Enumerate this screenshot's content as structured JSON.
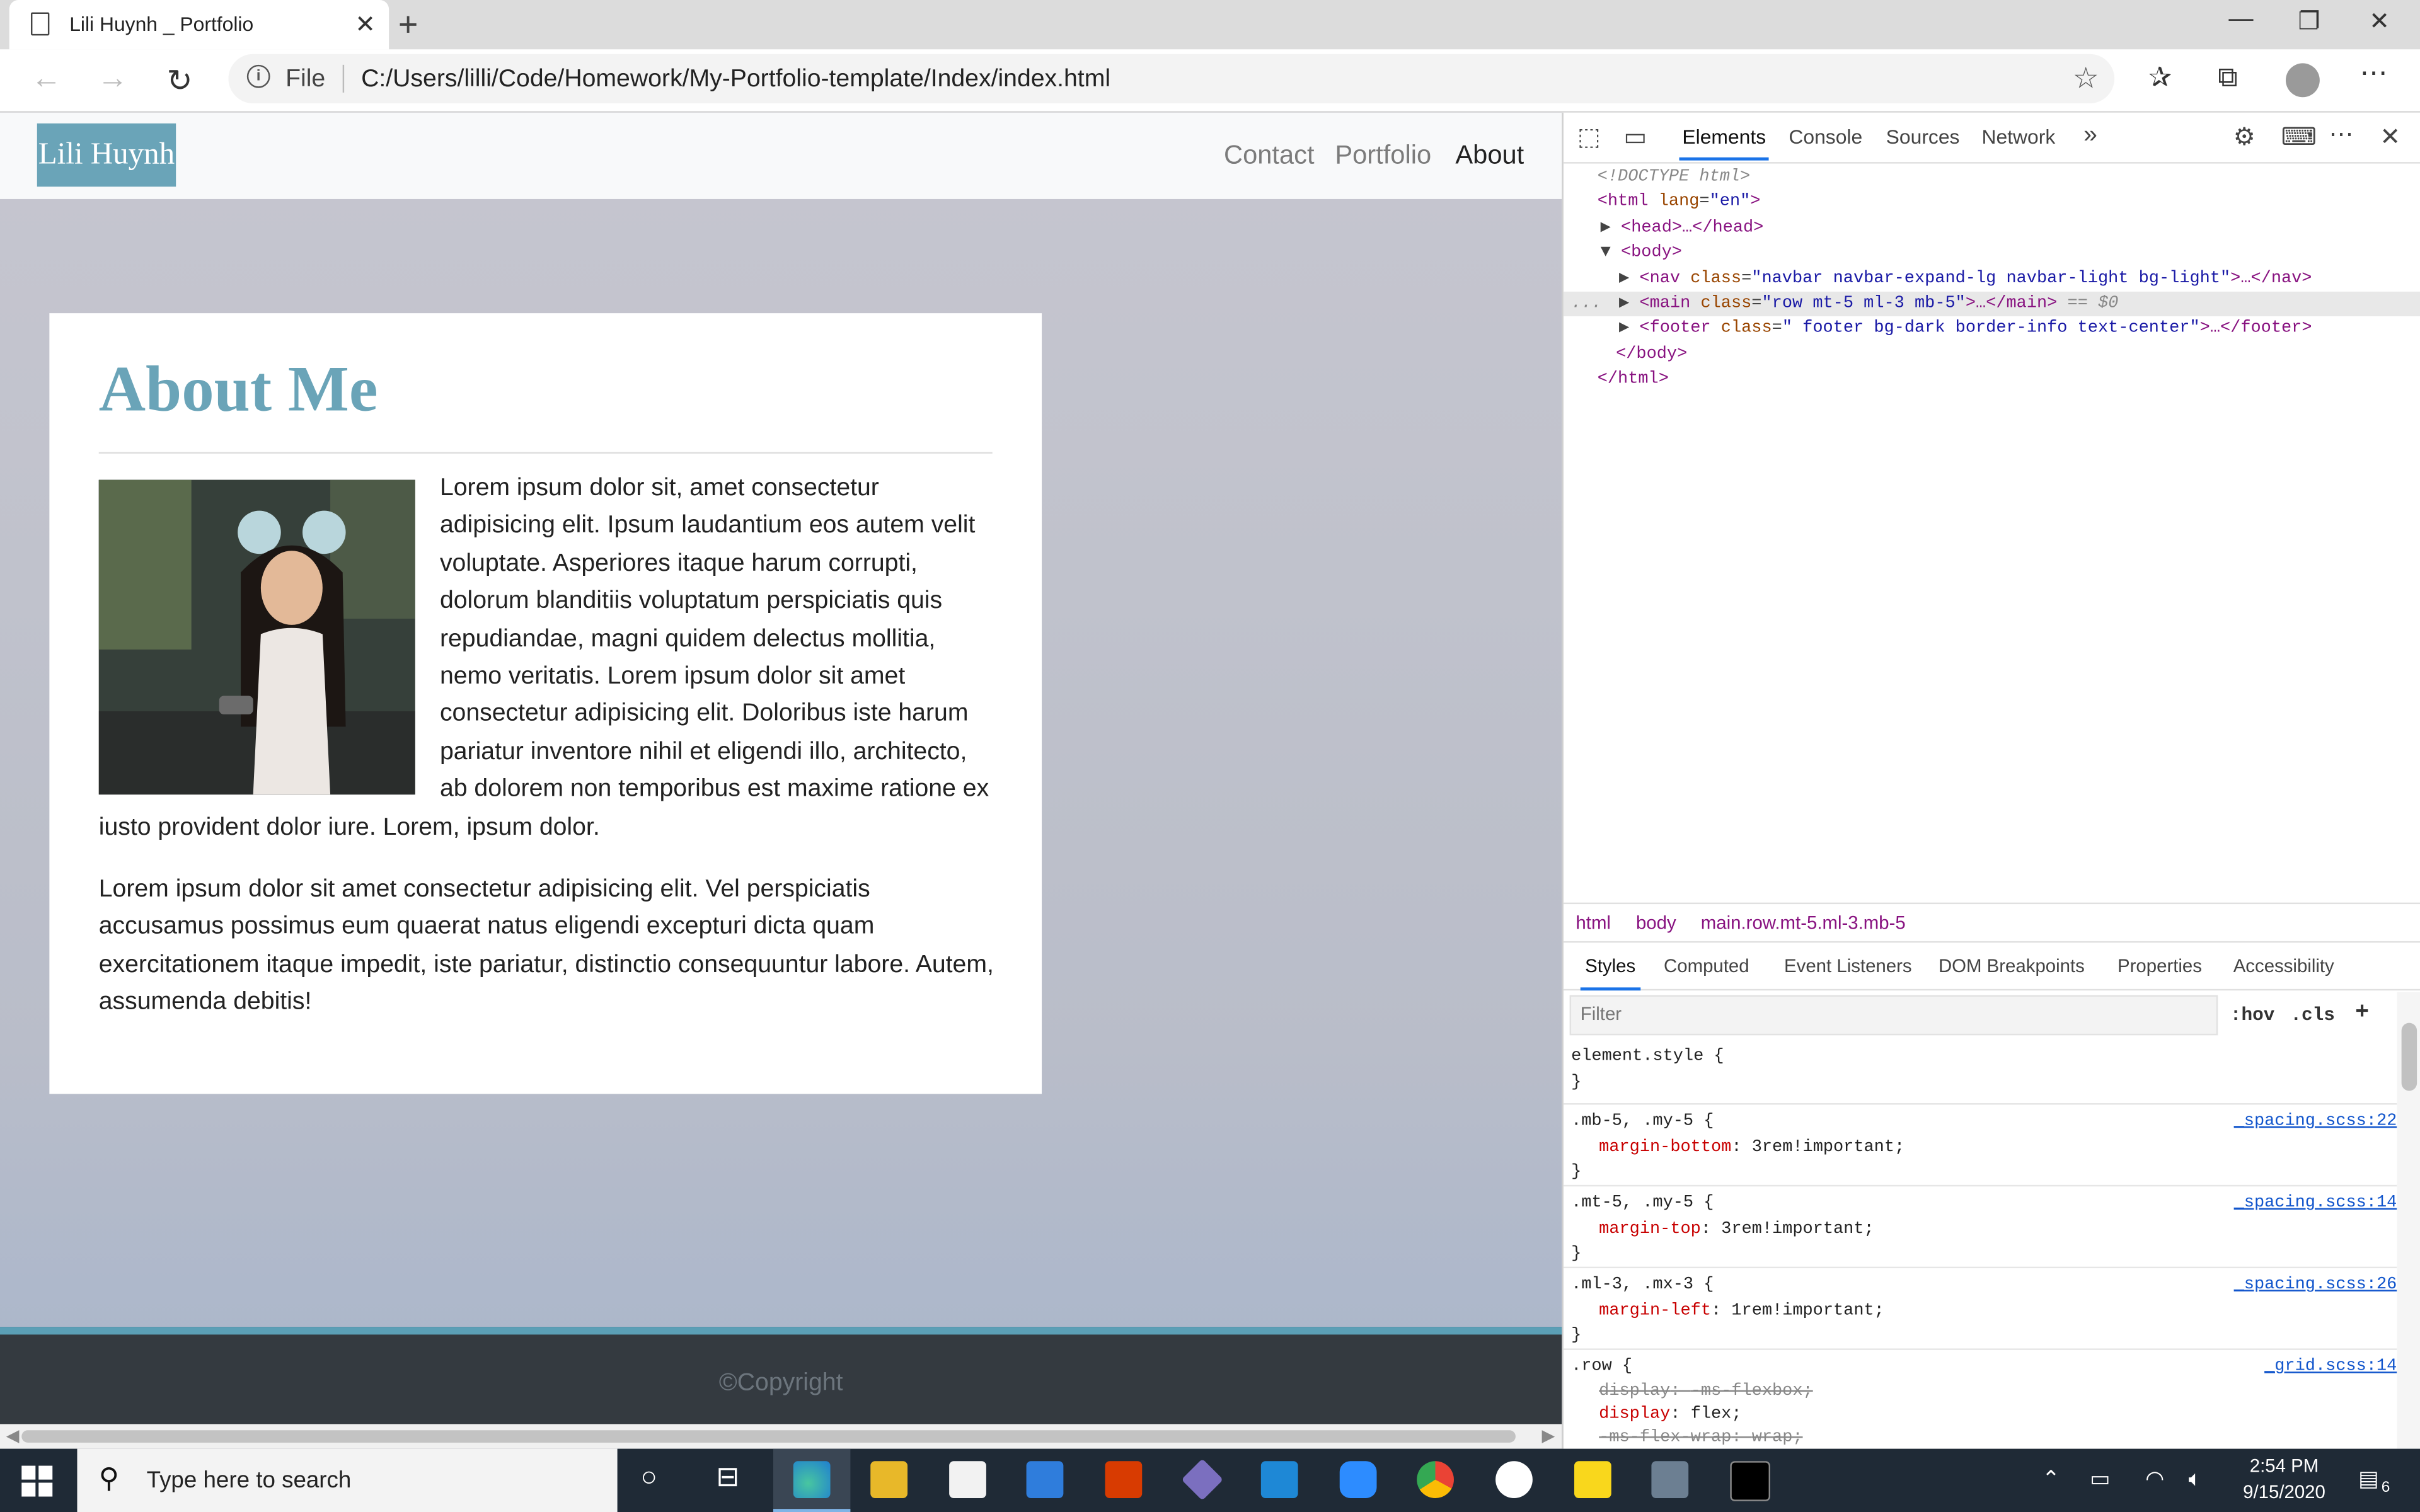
{
  "browser": {
    "tab_title": "Lili Huynh _ Portfolio",
    "file_label": "File",
    "url": "C:/Users/lilli/Code/Homework/My-Portfolio-template/Index/index.html"
  },
  "site": {
    "brand": "Lili Huynh",
    "nav": [
      "Contact",
      "Portfolio",
      "About"
    ],
    "active_nav": "About",
    "heading": "About Me",
    "paragraph1": "Lorem ipsum dolor sit, amet consectetur adipisicing elit. Ipsum laudantium eos autem velit voluptate. Asperiores itaque harum corrupti, dolorum blanditiis voluptatum perspiciatis quis repudiandae, magni quidem delectus mollitia, nemo veritatis. Lorem ipsum dolor sit amet consectetur adipisicing elit. Doloribus iste harum pariatur inventore nihil et eligendi illo, architecto, ab dolorem non temporibus est maxime ratione ex iusto provident dolor iure. Lorem, ipsum dolor.",
    "paragraph2": "Lorem ipsum dolor sit amet consectetur adipisicing elit. Vel perspiciatis accusamus possimus eum quaerat natus eligendi excepturi dicta quam exercitationem itaque impedit, iste pariatur, distinctio consequuntur labore. Autem, assumenda debitis!",
    "footer": "©Copyright"
  },
  "devtools": {
    "tabs": [
      "Elements",
      "Console",
      "Sources",
      "Network"
    ],
    "active_tab": "Elements",
    "dom": {
      "doctype": "<!DOCTYPE html>",
      "html_open": "<html",
      "html_lang_attr": "lang",
      "html_lang_val": "\"en\"",
      "head": "<head>…</head>",
      "body_open": "<body>",
      "nav_tag": "<nav",
      "nav_class": "\"navbar navbar-expand-lg navbar-light bg-light\"",
      "nav_end": ">…</nav>",
      "main_tag": "<main",
      "main_class": "\"row mt-5 ml-3 mb-5\"",
      "main_end": ">…</main>",
      "main_ref": "== $0",
      "footer_tag": "<footer",
      "footer_class": "\" footer bg-dark border-info text-center\"",
      "footer_end": ">…</footer>",
      "body_close": "</body>",
      "html_close": "</html>",
      "class_attr": "class",
      "ellipsis": "..."
    },
    "breadcrumbs": [
      "html",
      "body",
      "main.row.mt-5.ml-3.mb-5"
    ],
    "subtabs": [
      "Styles",
      "Computed",
      "Event Listeners",
      "DOM Breakpoints",
      "Properties",
      "Accessibility"
    ],
    "filter_placeholder": "Filter",
    "hov": ":hov",
    "cls": ".cls",
    "plus": "+",
    "rules": [
      {
        "selector": "element.style {",
        "props": [],
        "close": "}",
        "source": ""
      },
      {
        "selector": ".mb-5, .my-5 {",
        "props": [
          {
            "name": "margin-bottom",
            "value": "3rem!important;"
          }
        ],
        "close": "}",
        "source": "_spacing.scss:22"
      },
      {
        "selector": ".mt-5, .my-5 {",
        "props": [
          {
            "name": "margin-top",
            "value": "3rem!important;"
          }
        ],
        "close": "}",
        "source": "_spacing.scss:14"
      },
      {
        "selector": ".ml-3, .mx-3 {",
        "props": [
          {
            "name": "margin-left",
            "value": "1rem!important;"
          }
        ],
        "close": "}",
        "source": "_spacing.scss:26"
      },
      {
        "selector": ".row {",
        "props": [
          {
            "name": "display",
            "value": "-ms-flexbox;",
            "struck": true
          },
          {
            "name": "display",
            "value": "flex;"
          },
          {
            "name": "-ms-flex-wrap",
            "value": "wrap;",
            "struck": true
          }
        ],
        "close": "",
        "source": "_grid.scss:14"
      }
    ]
  },
  "taskbar": {
    "search_placeholder": "Type here to search",
    "time": "2:54 PM",
    "date": "9/15/2020",
    "notifications": "6"
  }
}
